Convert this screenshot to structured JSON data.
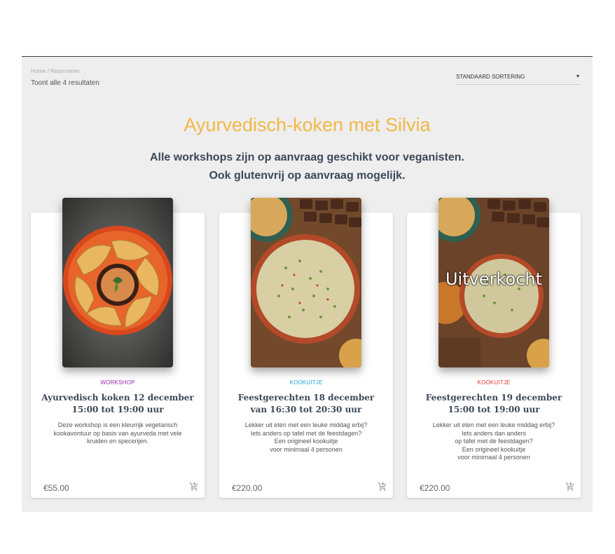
{
  "breadcrumb": {
    "home": "Home",
    "separator": " / ",
    "current": "Reserveren"
  },
  "result_count": "Toont alle 4 resultaten",
  "sort": {
    "selected": "STANDAARD SORTERING"
  },
  "page_title": "Ayurvedisch-koken met Silvia",
  "subtitle": {
    "line1": "Alle workshops zijn op aanvraag geschikt voor veganisten.",
    "line2": "Ook glutenvrij op aanvraag mogelijk."
  },
  "colors": {
    "title": "#f2b847",
    "category_workshop": "#9c27b0",
    "category_kookuitje_1": "#26a6d4",
    "category_kookuitje_2": "#e53935"
  },
  "products": [
    {
      "category": "WORKSHOP",
      "title": "Ayurvedisch koken 12 december 15:00 tot 19:00 uur",
      "description": "Deze workshop is een kleurrijk vegetarisch\nkookavontuur op basis van ayurveda  met vele\nkruiden en specerijen.",
      "price": "€55.00",
      "badge": ""
    },
    {
      "category": "KOOKUITJE",
      "title": "Feestgerechten 18 december van 16:30 tot 20:30 uur",
      "description": "Lekker uit eten met een leuke middag erbij?\nIets anders op tafel met de feestdagen?\nEen origineel kookuitje\nvoor minimaal 4 personen",
      "price": "€220.00",
      "badge": ""
    },
    {
      "category": "KOOKUITJE",
      "title": "Feestgerechten 19 december 15:00 tot 19:00 uur",
      "description": "Lekker uit eten met een leuke middag erbij?\nIets anders dan anders\nop tafel met de feestdagen?\nEen origineel kookuitje\nvoor minimaal 4 personen",
      "price": "€220.00",
      "badge": "Uitverkocht"
    }
  ]
}
